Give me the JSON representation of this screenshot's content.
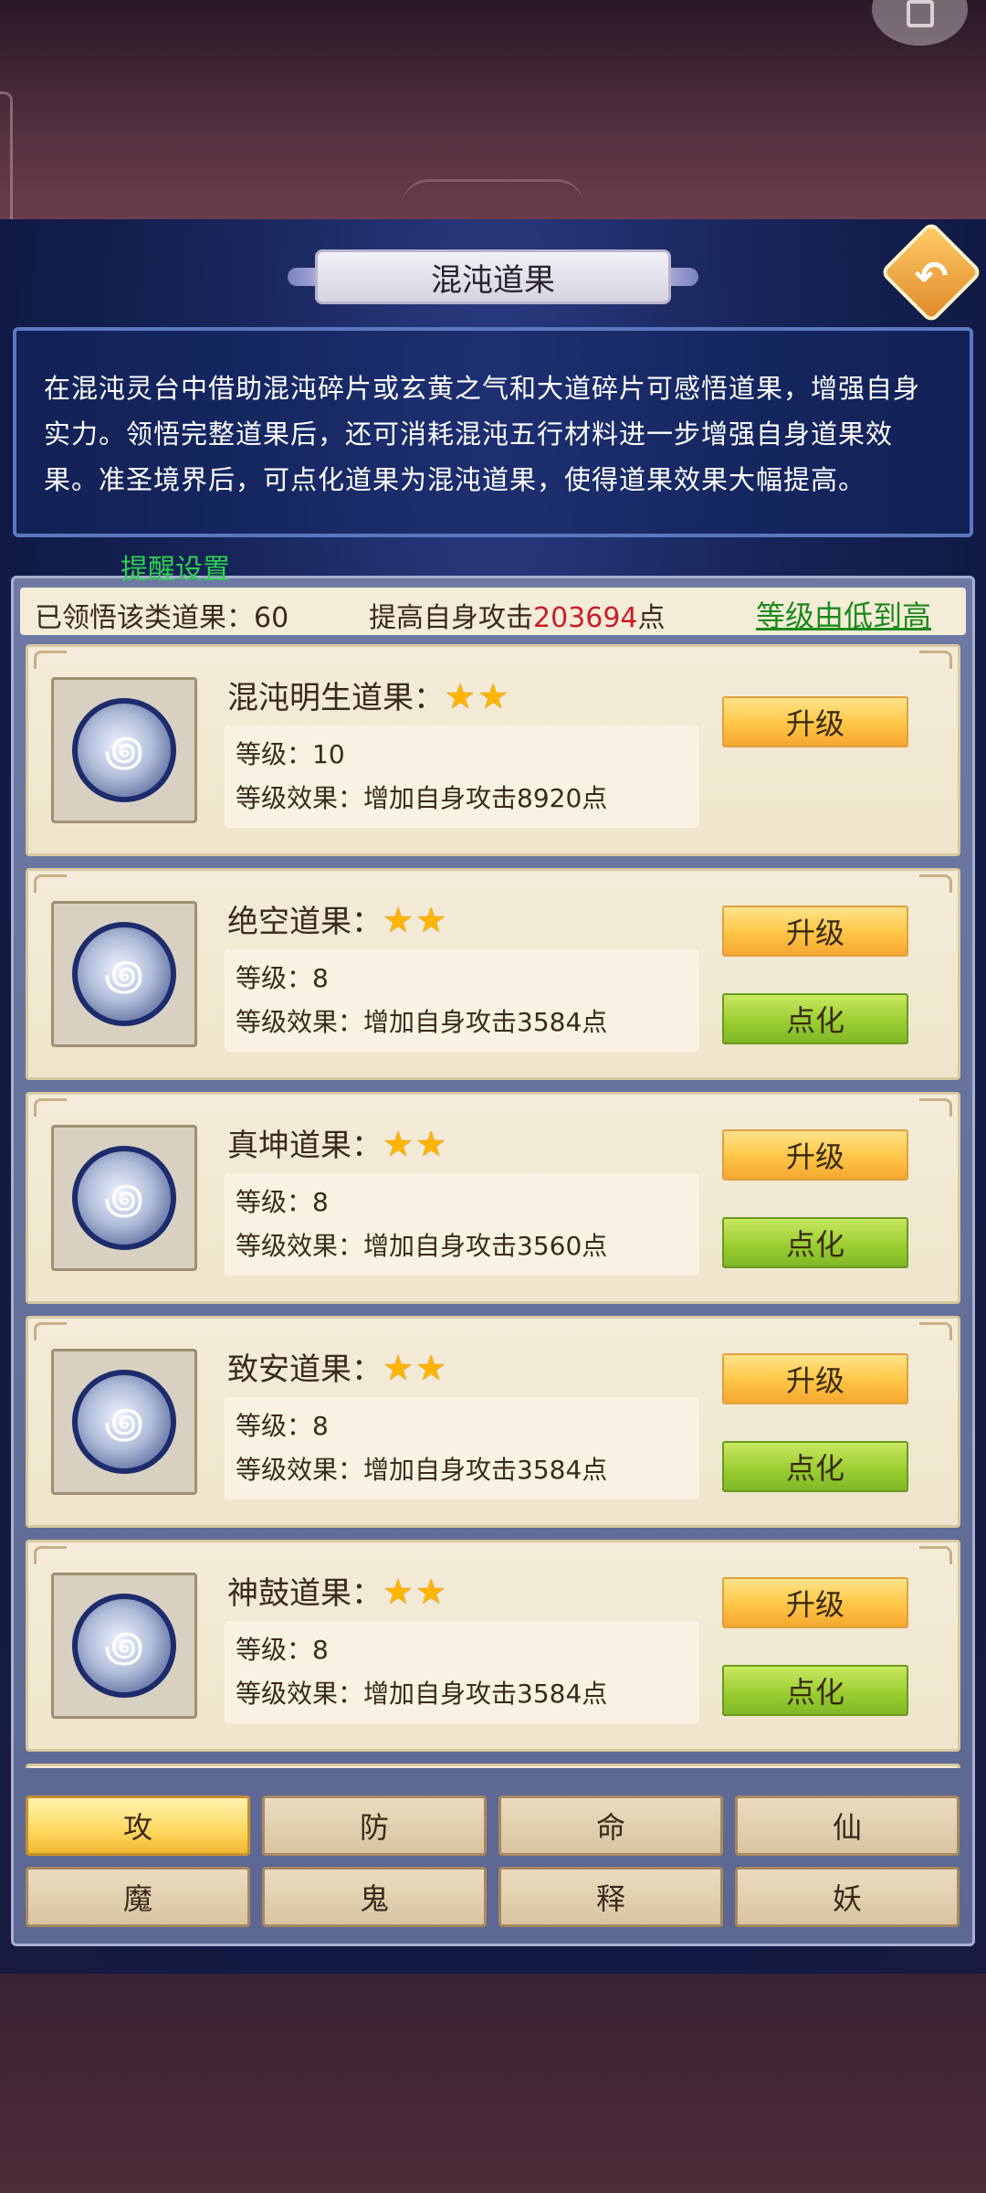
{
  "title": "混沌道果",
  "description": "在混沌灵台中借助混沌碎片或玄黄之气和大道碎片可感悟道果，增强自身实力。领悟完整道果后，还可消耗混沌五行材料进一步增强自身道果效果。准圣境界后，可点化道果为混沌道果，使得道果效果大幅提高。",
  "reminder_label": "提醒设置",
  "stats": {
    "learned": "已领悟该类道果：60",
    "attack_prefix": "提高自身攻击",
    "attack_value": "203694",
    "attack_suffix": "点",
    "sort_label": "等级由低到高"
  },
  "items": [
    {
      "name": "混沌明生道果：",
      "stars": "★★",
      "level": "等级：10",
      "effect": "等级效果：增加自身攻击8920点",
      "upgrade": "升级"
    },
    {
      "name": "绝空道果：",
      "stars": "★★",
      "level": "等级：8",
      "effect": "等级效果：增加自身攻击3584点",
      "upgrade": "升级",
      "refine": "点化"
    },
    {
      "name": "真坤道果：",
      "stars": "★★",
      "level": "等级：8",
      "effect": "等级效果：增加自身攻击3560点",
      "upgrade": "升级",
      "refine": "点化"
    },
    {
      "name": "致安道果：",
      "stars": "★★",
      "level": "等级：8",
      "effect": "等级效果：增加自身攻击3584点",
      "upgrade": "升级",
      "refine": "点化"
    },
    {
      "name": "神鼓道果：",
      "stars": "★★",
      "level": "等级：8",
      "effect": "等级效果：增加自身攻击3584点",
      "upgrade": "升级",
      "refine": "点化"
    }
  ],
  "tabs": [
    "攻",
    "防",
    "命",
    "仙",
    "魔",
    "鬼",
    "释",
    "妖"
  ],
  "active_tab": "攻",
  "icons": {
    "back": "back-arrow-icon",
    "orb": "dao-fruit-orb-icon",
    "corner": "puzzle-piece-icon"
  },
  "colors": {
    "attack_value": "#c81e28",
    "sort_link": "#1a8a1a",
    "reminder": "#2ed050",
    "upgrade_button": "#ffc84a",
    "refine_button": "#98cc30"
  }
}
